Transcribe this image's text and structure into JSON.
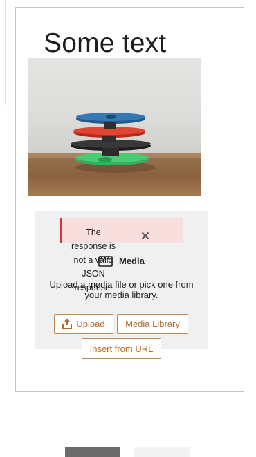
{
  "heading": {
    "text": "Some text"
  },
  "image": {
    "subject": "stacked fidget spinners",
    "colors": {
      "top": "#2e6fa3",
      "second": "#d83a2a",
      "third": "#2a2a2a",
      "bottom": "#3fbf6a"
    }
  },
  "notice": {
    "message": "The response is not a valid JSON response.",
    "dismiss_icon": "close-icon",
    "status_color": "#d63638"
  },
  "media_placeholder": {
    "label": "Media",
    "icon": "media-icon",
    "instructions": "Upload a media file or pick one from your media library.",
    "upload_label": "Upload",
    "upload_icon": "upload-icon",
    "library_label": "Media Library",
    "url_label": "Insert from URL",
    "accent_color": "#b06a2c"
  }
}
